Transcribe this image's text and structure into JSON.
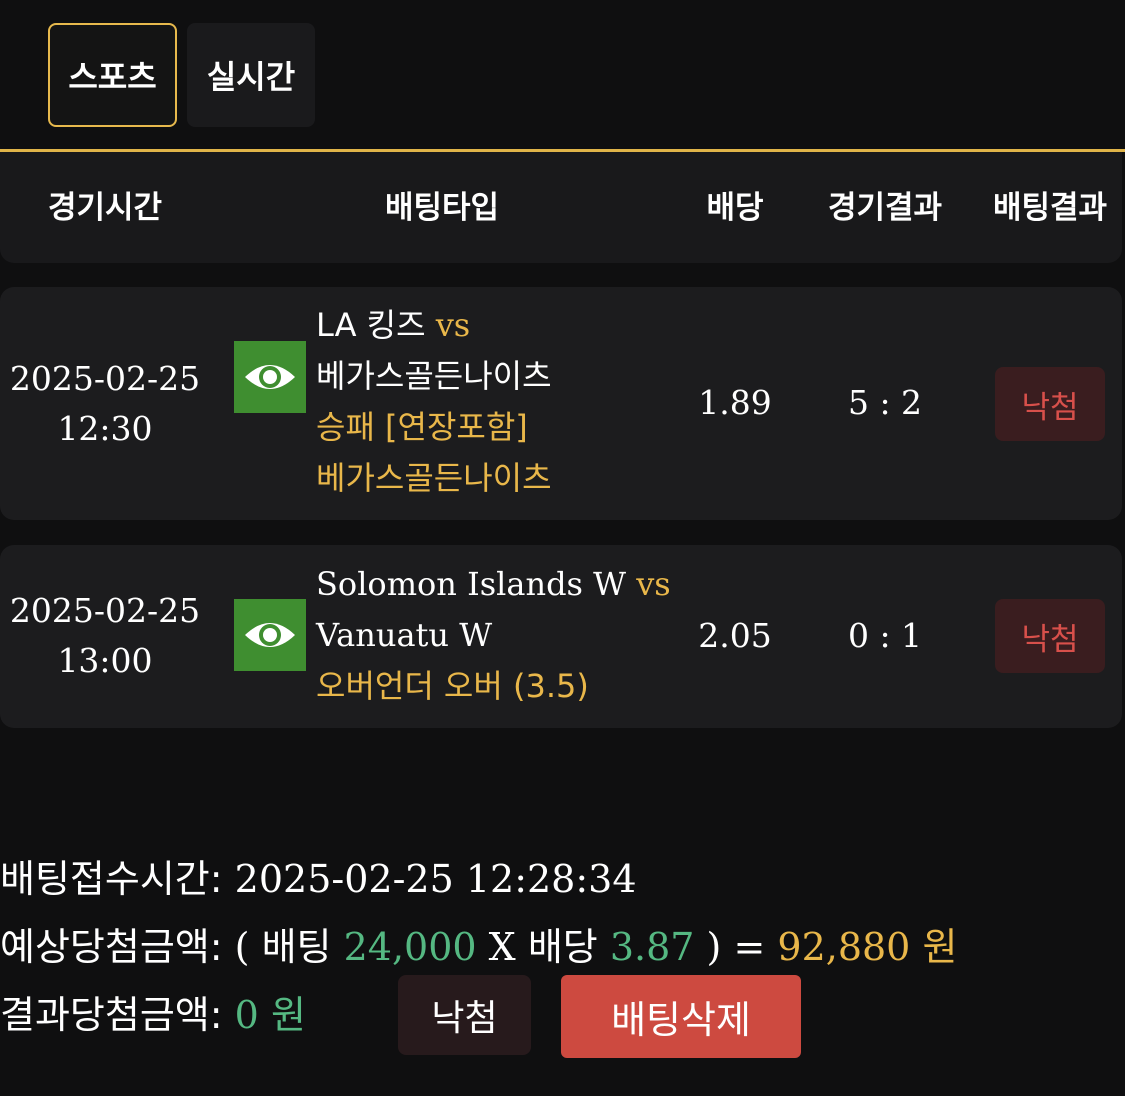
{
  "tabs": [
    {
      "label": "스포츠",
      "active": true
    },
    {
      "label": "실시간",
      "active": false
    }
  ],
  "columns": {
    "time": "경기시간",
    "type": "배팅타입",
    "odds": "배당",
    "game_result": "경기결과",
    "bet_result": "배팅결과"
  },
  "bets": [
    {
      "date": "2025-02-25",
      "time": "12:30",
      "icon": "eye-icon",
      "home": "LA 킹즈",
      "vs": "vs",
      "away": "베가스골든나이츠",
      "market": "승패 [연장포함]",
      "pick": "베가스골든나이츠",
      "odds": "1.89",
      "score": "5 : 2",
      "result": "낙첨"
    },
    {
      "date": "2025-02-25",
      "time": "13:00",
      "icon": "eye-icon",
      "home": "Solomon Islands W",
      "vs": "vs",
      "away": "Vanuatu W",
      "market": "오버언더 오버 (3.5)",
      "odds": "2.05",
      "score": "0 : 1",
      "result": "낙첨"
    }
  ],
  "summary": {
    "received_label": "배팅접수시간:",
    "received_value": "2025-02-25 12:28:34",
    "expected_label": "예상당첨금액:",
    "open_paren": "(",
    "bet_word": "배팅",
    "stake": "24,000",
    "times": "X",
    "odds_word": "배당",
    "total_odds": "3.87",
    "close_eq": ") =",
    "expected_amount": "92,880",
    "won": "원",
    "result_label": "결과당첨금액:",
    "result_amount": "0",
    "result_won": "원"
  },
  "buttons": {
    "status": "낙첨",
    "delete": "배팅삭제"
  },
  "colors": {
    "accent": "#e0b449",
    "gold_text": "#e9b74a",
    "green_text": "#55b882",
    "lose_badge": "#d8504b",
    "delete_button": "#cd4a40",
    "eye_button": "#3f8e30"
  }
}
